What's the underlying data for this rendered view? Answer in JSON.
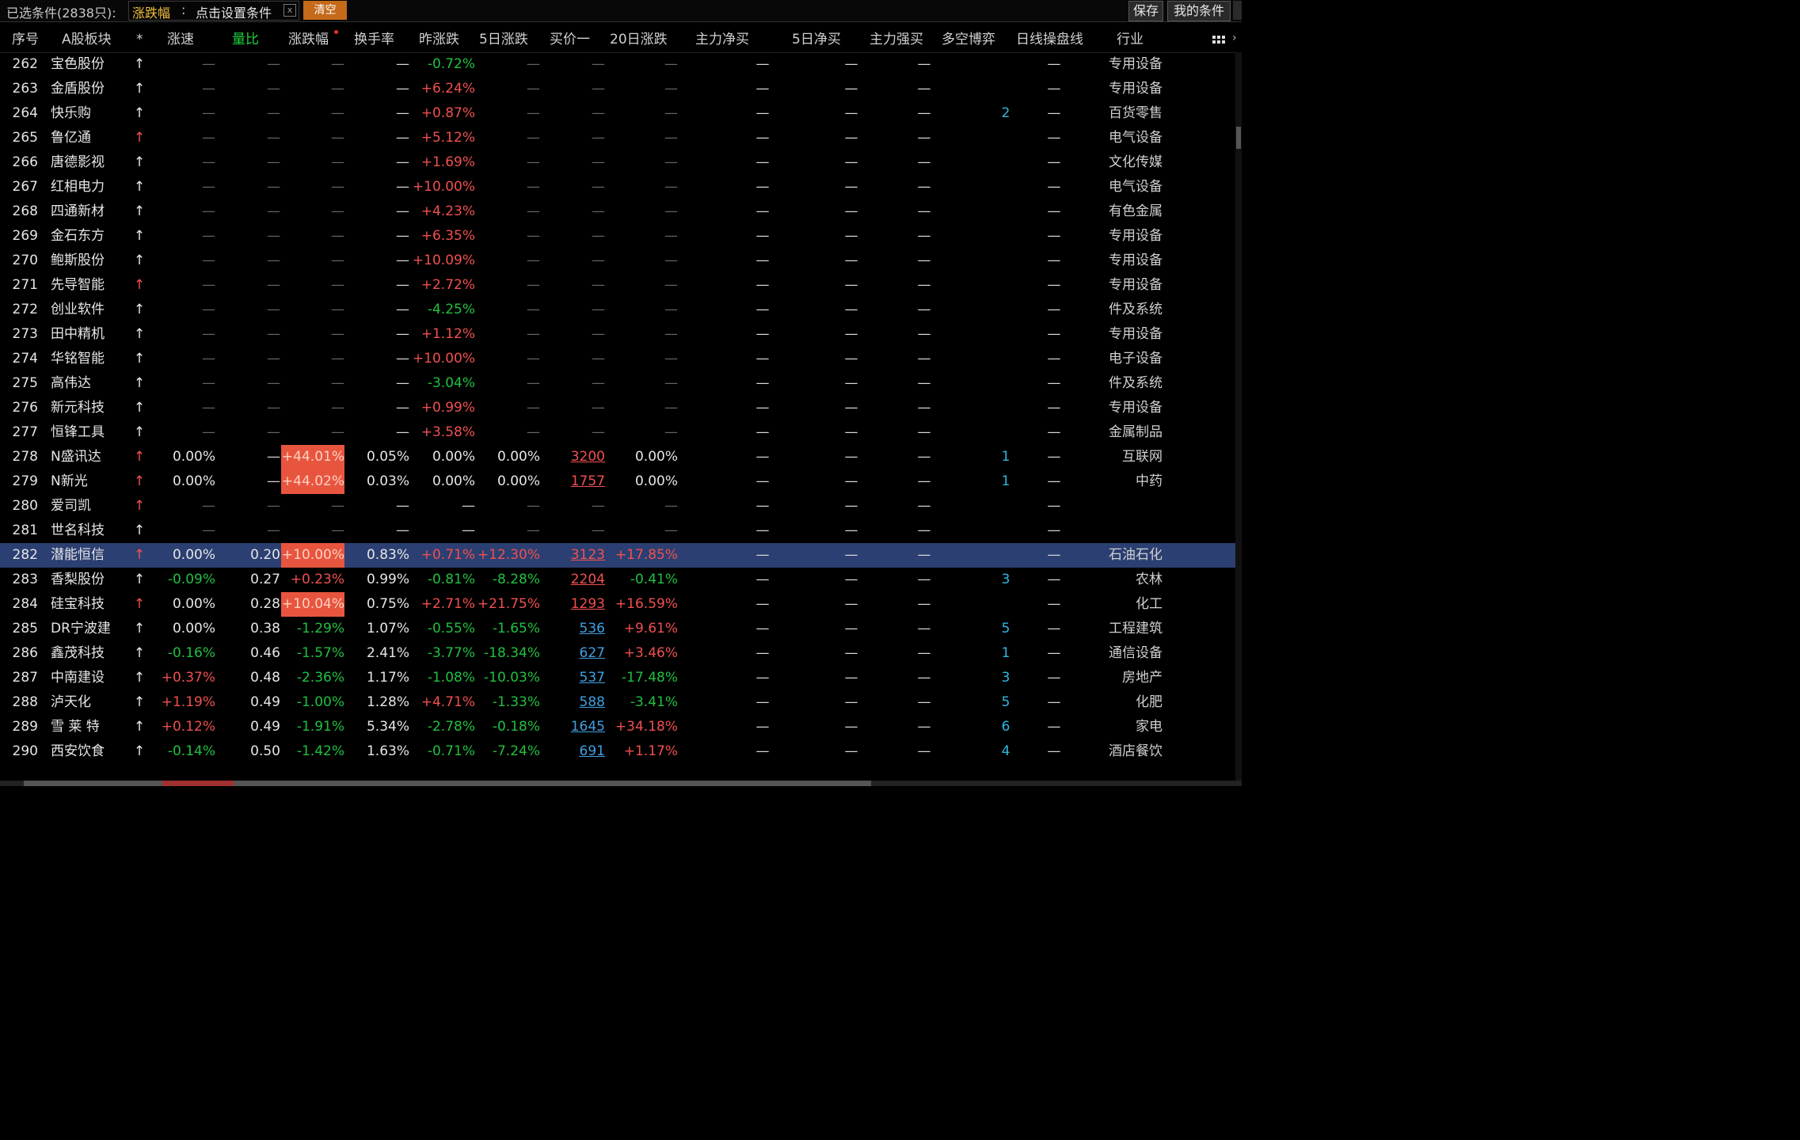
{
  "topbar": {
    "filter_label": "已选条件(2838只):",
    "filter_name": "涨跌幅",
    "filter_sep": ":",
    "filter_hint": "点击设置条件",
    "close_glyph": "x",
    "clear_label": "清空",
    "save_label": "保存",
    "my_conditions_label": "我的条件"
  },
  "columns": {
    "idx": "序号",
    "name": "A股板块",
    "star": "*",
    "speed": "涨速",
    "vol_ratio": "量比",
    "chg": "涨跌幅",
    "turnover": "换手率",
    "prev_chg": "昨涨跌",
    "chg5": "5日涨跌",
    "buy1": "买价一",
    "chg20": "20日涨跌",
    "main_net": "主力净买",
    "net5": "5日净买",
    "main_strong": "主力强买",
    "longshort": "多空博弈",
    "daily": "日线操盘线",
    "industry": "行业"
  },
  "rows": [
    {
      "idx": "262",
      "name": "宝色股份",
      "star": "↑",
      "star_color": "w",
      "speed": "—",
      "vol": "—",
      "chg": "—",
      "turnover": "—",
      "prev": "-0.72%",
      "chg5": "—",
      "buy": "—",
      "chg20": "—",
      "ls": "",
      "daily": "—",
      "industry": "专用设备"
    },
    {
      "idx": "263",
      "name": "金盾股份",
      "star": "↑",
      "star_color": "w",
      "speed": "—",
      "vol": "—",
      "chg": "—",
      "turnover": "—",
      "prev": "+6.24%",
      "chg5": "—",
      "buy": "—",
      "chg20": "—",
      "ls": "",
      "daily": "—",
      "industry": "专用设备"
    },
    {
      "idx": "264",
      "name": "快乐购",
      "star": "↑",
      "star_color": "w",
      "speed": "—",
      "vol": "—",
      "chg": "—",
      "turnover": "—",
      "prev": "+0.87%",
      "chg5": "—",
      "buy": "—",
      "chg20": "—",
      "ls": "2",
      "daily": "—",
      "industry": "百货零售"
    },
    {
      "idx": "265",
      "name": "鲁亿通",
      "star": "↑",
      "star_color": "r",
      "speed": "—",
      "vol": "—",
      "chg": "—",
      "turnover": "—",
      "prev": "+5.12%",
      "chg5": "—",
      "buy": "—",
      "chg20": "—",
      "ls": "",
      "daily": "—",
      "industry": "电气设备"
    },
    {
      "idx": "266",
      "name": "唐德影视",
      "star": "↑",
      "star_color": "w",
      "speed": "—",
      "vol": "—",
      "chg": "—",
      "turnover": "—",
      "prev": "+1.69%",
      "chg5": "—",
      "buy": "—",
      "chg20": "—",
      "ls": "",
      "daily": "—",
      "industry": "文化传媒"
    },
    {
      "idx": "267",
      "name": "红相电力",
      "star": "↑",
      "star_color": "w",
      "speed": "—",
      "vol": "—",
      "chg": "—",
      "turnover": "—",
      "prev": "+10.00%",
      "chg5": "—",
      "buy": "—",
      "chg20": "—",
      "ls": "",
      "daily": "—",
      "industry": "电气设备"
    },
    {
      "idx": "268",
      "name": "四通新材",
      "star": "↑",
      "star_color": "w",
      "speed": "—",
      "vol": "—",
      "chg": "—",
      "turnover": "—",
      "prev": "+4.23%",
      "chg5": "—",
      "buy": "—",
      "chg20": "—",
      "ls": "",
      "daily": "—",
      "industry": "有色金属"
    },
    {
      "idx": "269",
      "name": "金石东方",
      "star": "↑",
      "star_color": "w",
      "speed": "—",
      "vol": "—",
      "chg": "—",
      "turnover": "—",
      "prev": "+6.35%",
      "chg5": "—",
      "buy": "—",
      "chg20": "—",
      "ls": "",
      "daily": "—",
      "industry": "专用设备"
    },
    {
      "idx": "270",
      "name": "鲍斯股份",
      "star": "↑",
      "star_color": "w",
      "speed": "—",
      "vol": "—",
      "chg": "—",
      "turnover": "—",
      "prev": "+10.09%",
      "chg5": "—",
      "buy": "—",
      "chg20": "—",
      "ls": "",
      "daily": "—",
      "industry": "专用设备"
    },
    {
      "idx": "271",
      "name": "先导智能",
      "star": "↑",
      "star_color": "r",
      "speed": "—",
      "vol": "—",
      "chg": "—",
      "turnover": "—",
      "prev": "+2.72%",
      "chg5": "—",
      "buy": "—",
      "chg20": "—",
      "ls": "",
      "daily": "—",
      "industry": "专用设备"
    },
    {
      "idx": "272",
      "name": "创业软件",
      "star": "↑",
      "star_color": "w",
      "speed": "—",
      "vol": "—",
      "chg": "—",
      "turnover": "—",
      "prev": "-4.25%",
      "chg5": "—",
      "buy": "—",
      "chg20": "—",
      "ls": "",
      "daily": "—",
      "industry": "件及系统"
    },
    {
      "idx": "273",
      "name": "田中精机",
      "star": "↑",
      "star_color": "w",
      "speed": "—",
      "vol": "—",
      "chg": "—",
      "turnover": "—",
      "prev": "+1.12%",
      "chg5": "—",
      "buy": "—",
      "chg20": "—",
      "ls": "",
      "daily": "—",
      "industry": "专用设备"
    },
    {
      "idx": "274",
      "name": "华铭智能",
      "star": "↑",
      "star_color": "w",
      "speed": "—",
      "vol": "—",
      "chg": "—",
      "turnover": "—",
      "prev": "+10.00%",
      "chg5": "—",
      "buy": "—",
      "chg20": "—",
      "ls": "",
      "daily": "—",
      "industry": "电子设备"
    },
    {
      "idx": "275",
      "name": "高伟达",
      "star": "↑",
      "star_color": "w",
      "speed": "—",
      "vol": "—",
      "chg": "—",
      "turnover": "—",
      "prev": "-3.04%",
      "chg5": "—",
      "buy": "—",
      "chg20": "—",
      "ls": "",
      "daily": "—",
      "industry": "件及系统"
    },
    {
      "idx": "276",
      "name": "新元科技",
      "star": "↑",
      "star_color": "w",
      "speed": "—",
      "vol": "—",
      "chg": "—",
      "turnover": "—",
      "prev": "+0.99%",
      "chg5": "—",
      "buy": "—",
      "chg20": "—",
      "ls": "",
      "daily": "—",
      "industry": "专用设备"
    },
    {
      "idx": "277",
      "name": "恒锋工具",
      "star": "↑",
      "star_color": "w",
      "speed": "—",
      "vol": "—",
      "chg": "—",
      "turnover": "—",
      "prev": "+3.58%",
      "chg5": "—",
      "buy": "—",
      "chg20": "—",
      "ls": "",
      "daily": "—",
      "industry": "金属制品"
    },
    {
      "idx": "278",
      "name": "N盛讯达",
      "star": "↑",
      "star_color": "r",
      "speed": "0.00%",
      "vol": "—",
      "chg": "+44.01%",
      "chg_box": true,
      "turnover": "0.05%",
      "prev": "0.00%",
      "chg5": "0.00%",
      "buy": "3200",
      "chg20": "0.00%",
      "ls": "1",
      "daily": "—",
      "industry": "互联网"
    },
    {
      "idx": "279",
      "name": "N新光",
      "star": "↑",
      "star_color": "r",
      "speed": "0.00%",
      "vol": "—",
      "chg": "+44.02%",
      "chg_box": true,
      "turnover": "0.03%",
      "prev": "0.00%",
      "chg5": "0.00%",
      "buy": "1757",
      "chg20": "0.00%",
      "ls": "1",
      "daily": "—",
      "industry": "中药"
    },
    {
      "idx": "280",
      "name": "爱司凯",
      "star": "↑",
      "star_color": "r",
      "speed": "—",
      "vol": "—",
      "chg": "—",
      "turnover": "—",
      "prev": "—",
      "chg5": "—",
      "buy": "—",
      "chg20": "—",
      "ls": "",
      "daily": "—",
      "industry": ""
    },
    {
      "idx": "281",
      "name": "世名科技",
      "star": "↑",
      "star_color": "w",
      "speed": "—",
      "vol": "—",
      "chg": "—",
      "turnover": "—",
      "prev": "—",
      "chg5": "—",
      "buy": "—",
      "chg20": "—",
      "ls": "",
      "daily": "—",
      "industry": ""
    },
    {
      "idx": "282",
      "name": "潜能恒信",
      "star": "↑",
      "star_color": "r",
      "speed": "0.00%",
      "vol": "0.20",
      "chg": "+10.00%",
      "chg_box": true,
      "turnover": "0.83%",
      "prev": "+0.71%",
      "chg5": "+12.30%",
      "buy": "3123",
      "chg20": "+17.85%",
      "ls": "",
      "daily": "—",
      "industry": "石油石化",
      "selected": true
    },
    {
      "idx": "283",
      "name": "香梨股份",
      "star": "↑",
      "star_color": "w",
      "speed": "-0.09%",
      "vol": "0.27",
      "chg": "+0.23%",
      "turnover": "0.99%",
      "prev": "-0.81%",
      "chg5": "-8.28%",
      "buy": "2204",
      "chg20": "-0.41%",
      "ls": "3",
      "daily": "—",
      "industry": "农林"
    },
    {
      "idx": "284",
      "name": "硅宝科技",
      "star": "↑",
      "star_color": "r",
      "speed": "0.00%",
      "vol": "0.28",
      "chg": "+10.04%",
      "chg_box": true,
      "turnover": "0.75%",
      "prev": "+2.71%",
      "chg5": "+21.75%",
      "buy": "1293",
      "chg20": "+16.59%",
      "ls": "",
      "daily": "—",
      "industry": "化工"
    },
    {
      "idx": "285",
      "name": "DR宁波建",
      "star": "↑",
      "star_color": "w",
      "speed": "0.00%",
      "vol": "0.38",
      "chg": "-1.29%",
      "turnover": "1.07%",
      "prev": "-0.55%",
      "chg5": "-1.65%",
      "buy": "536",
      "buy_blue": true,
      "chg20": "+9.61%",
      "ls": "5",
      "daily": "—",
      "industry": "工程建筑"
    },
    {
      "idx": "286",
      "name": "鑫茂科技",
      "star": "↑",
      "star_color": "w",
      "speed": "-0.16%",
      "vol": "0.46",
      "chg": "-1.57%",
      "turnover": "2.41%",
      "prev": "-3.77%",
      "chg5": "-18.34%",
      "buy": "627",
      "buy_blue": true,
      "chg20": "+3.46%",
      "ls": "1",
      "daily": "—",
      "industry": "通信设备"
    },
    {
      "idx": "287",
      "name": "中南建设",
      "star": "↑",
      "star_color": "w",
      "speed": "+0.37%",
      "vol": "0.48",
      "chg": "-2.36%",
      "turnover": "1.17%",
      "prev": "-1.08%",
      "chg5": "-10.03%",
      "buy": "537",
      "buy_blue": true,
      "chg20": "-17.48%",
      "ls": "3",
      "daily": "—",
      "industry": "房地产"
    },
    {
      "idx": "288",
      "name": "泸天化",
      "star": "↑",
      "star_color": "w",
      "speed": "+1.19%",
      "vol": "0.49",
      "chg": "-1.00%",
      "turnover": "1.28%",
      "prev": "+4.71%",
      "chg5": "-1.33%",
      "buy": "588",
      "buy_blue": true,
      "chg20": "-3.41%",
      "ls": "5",
      "daily": "—",
      "industry": "化肥"
    },
    {
      "idx": "289",
      "name": "雪 莱 特",
      "star": "↑",
      "star_color": "w",
      "speed": "+0.12%",
      "vol": "0.49",
      "chg": "-1.91%",
      "turnover": "5.34%",
      "prev": "-2.78%",
      "chg5": "-0.18%",
      "buy": "1645",
      "buy_blue": true,
      "chg20": "+34.18%",
      "ls": "6",
      "daily": "—",
      "industry": "家电"
    },
    {
      "idx": "290",
      "name": "西安饮食",
      "star": "↑",
      "star_color": "w",
      "speed": "-0.14%",
      "vol": "0.50",
      "chg": "-1.42%",
      "turnover": "1.63%",
      "prev": "-0.71%",
      "chg5": "-7.24%",
      "buy": "691",
      "buy_blue": true,
      "chg20": "+1.17%",
      "ls": "4",
      "daily": "—",
      "industry": "酒店餐饮"
    }
  ],
  "colors": {
    "up": "#f05050",
    "down": "#20c040",
    "selected_row": "#2c3f72",
    "limit_box": "#e8553f",
    "sorted_header": "#20d040"
  },
  "icons": {
    "grid": "grid-view-icon",
    "close": "close-icon",
    "sort": "sort-indicator-dot",
    "star": "arrow-up-icon"
  }
}
